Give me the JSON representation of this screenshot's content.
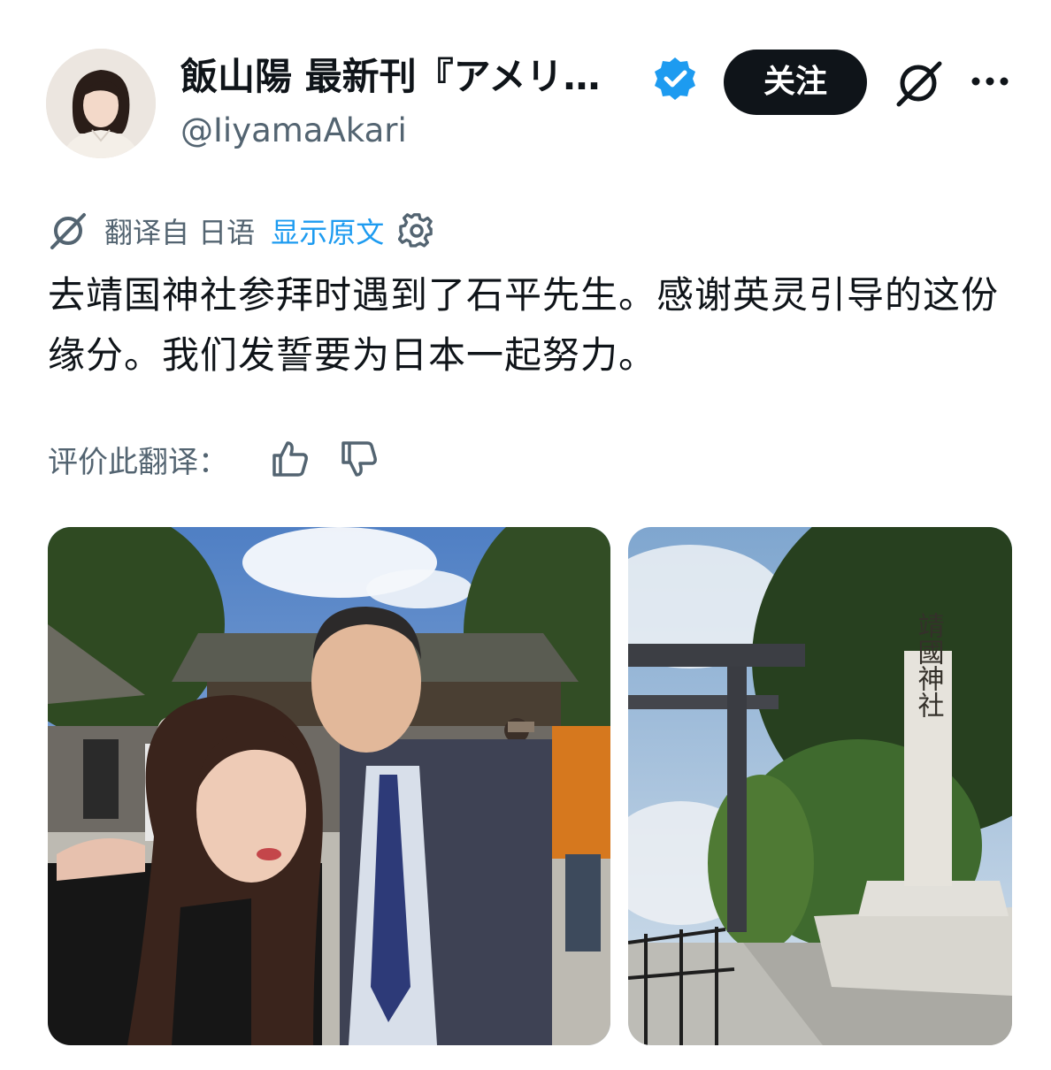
{
  "header": {
    "display_name": "飯山陽 最新刊『アメリ…",
    "handle": "@IiyamaAkari",
    "follow_label": "关注"
  },
  "translation": {
    "label": "翻译自 日语",
    "show_original": "显示原文"
  },
  "tweet": {
    "text": "去靖国神社参拜时遇到了石平先生。感谢英灵引导的这份缘分。我们发誓要为日本一起努力。"
  },
  "rating": {
    "label": "评价此翻译："
  },
  "media": {
    "photo2_pillar_text": "靖國神社"
  },
  "colors": {
    "accent": "#1d9bf0",
    "follow_bg": "#0f1419",
    "secondary_text": "#536471"
  }
}
